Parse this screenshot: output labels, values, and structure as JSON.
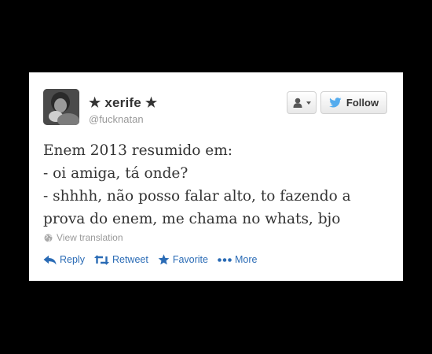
{
  "colors": {
    "background": "#000000",
    "card": "#ffffff",
    "link": "#2a6bb5",
    "twitter_blue": "#55acee",
    "muted": "#999999",
    "text": "#333333"
  },
  "author": {
    "display_name": "★ xerife ★",
    "screen_name": "@fucknatan"
  },
  "header": {
    "user_menu_icon": "user-dropdown-icon",
    "follow_label": "Follow",
    "follow_icon": "twitter-bird-icon"
  },
  "tweet": {
    "lines": [
      "Enem 2013 resumido em:",
      "- oi amiga, tá onde?",
      "- shhhh, não posso falar alto, to fazendo a",
      "prova do enem, me chama no whats, bjo"
    ]
  },
  "translation": {
    "label": "View translation",
    "icon": "globe-icon"
  },
  "actions": [
    {
      "label": "Reply",
      "icon": "reply-icon"
    },
    {
      "label": "Retweet",
      "icon": "retweet-icon"
    },
    {
      "label": "Favorite",
      "icon": "star-icon"
    },
    {
      "label": "More",
      "icon": "more-icon"
    }
  ]
}
